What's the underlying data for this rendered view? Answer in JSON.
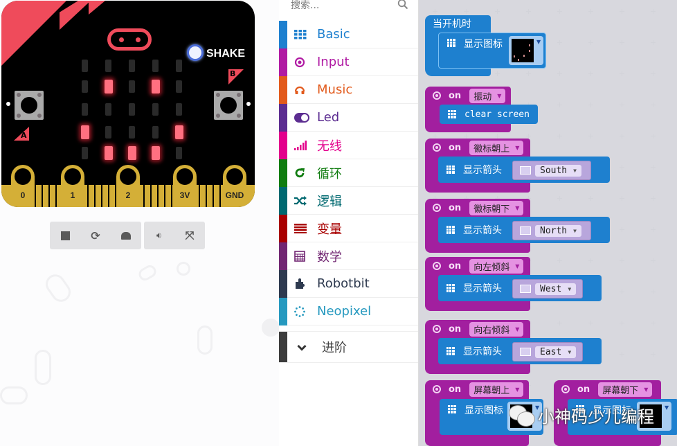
{
  "simulator": {
    "shake_label": "SHAKE",
    "button_a": "A",
    "button_b": "B",
    "pins": [
      "0",
      "1",
      "2",
      "3V",
      "GND"
    ],
    "led_matrix": [
      [
        0,
        0,
        0,
        0,
        0
      ],
      [
        0,
        1,
        0,
        1,
        0
      ],
      [
        0,
        0,
        0,
        0,
        0
      ],
      [
        1,
        0,
        0,
        0,
        1
      ],
      [
        0,
        1,
        1,
        1,
        0
      ]
    ],
    "controls": [
      "stop-icon",
      "restart-icon",
      "slowmo-icon",
      "mute-icon",
      "fullscreen-icon"
    ]
  },
  "toolbox": {
    "search_placeholder": "搜索...",
    "categories": [
      {
        "label": "Basic",
        "icon": "grid-icon",
        "color": "#1e80cf"
      },
      {
        "label": "Input",
        "icon": "target-icon",
        "color": "#b01aa3"
      },
      {
        "label": "Music",
        "icon": "headphones-icon",
        "color": "#e25a1c"
      },
      {
        "label": "Led",
        "icon": "toggle-icon",
        "color": "#5c2d91"
      },
      {
        "label": "无线",
        "icon": "signal-icon",
        "color": "#e3008c"
      },
      {
        "label": "循环",
        "icon": "refresh-icon",
        "color": "#107c10"
      },
      {
        "label": "逻辑",
        "icon": "shuffle-icon",
        "color": "#006970"
      },
      {
        "label": "变量",
        "icon": "list-icon",
        "color": "#a80000"
      },
      {
        "label": "数学",
        "icon": "calculator-icon",
        "color": "#712672"
      },
      {
        "label": "Robotbit",
        "icon": "puzzle-icon",
        "color": "#2e3a4f"
      },
      {
        "label": "Neopixel",
        "icon": "neopixel-icon",
        "color": "#2699bf"
      }
    ],
    "advanced_label": "进阶"
  },
  "workspace": {
    "blocks": [
      {
        "type": "on-start",
        "hat_label": "当开机时",
        "statement": "显示图标",
        "arg": "icon"
      },
      {
        "type": "on-gesture",
        "on_label": "on",
        "gesture": "振动",
        "statement": "clear screen"
      },
      {
        "type": "on-gesture",
        "on_label": "on",
        "gesture": "徽标朝上",
        "statement": "显示箭头",
        "arg": "South"
      },
      {
        "type": "on-gesture",
        "on_label": "on",
        "gesture": "徽标朝下",
        "statement": "显示箭头",
        "arg": "North"
      },
      {
        "type": "on-gesture",
        "on_label": "on",
        "gesture": "向左倾斜",
        "statement": "显示箭头",
        "arg": "West"
      },
      {
        "type": "on-gesture",
        "on_label": "on",
        "gesture": "向右倾斜",
        "statement": "显示箭头",
        "arg": "East"
      },
      {
        "type": "on-gesture",
        "on_label": "on",
        "gesture": "屏幕朝上",
        "statement": "显示图标",
        "arg": "icon"
      },
      {
        "type": "on-gesture",
        "on_label": "on",
        "gesture": "屏幕朝下",
        "statement": "显示图标",
        "arg": "icon"
      }
    ]
  },
  "watermark": "小神码少儿编程",
  "colors": {
    "event_purple": "#a21f9f",
    "basic_blue": "#1e80cf",
    "board_red": "#ef4b5b",
    "gold": "#d4af37"
  }
}
